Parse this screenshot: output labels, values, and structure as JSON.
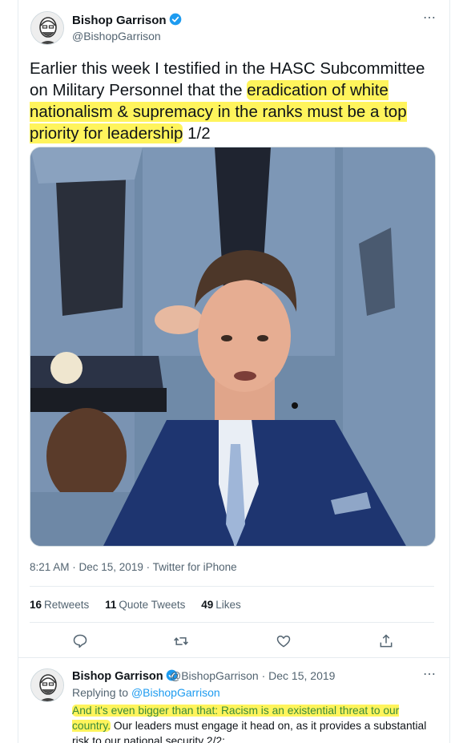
{
  "tweet": {
    "author_name": "Bishop Garrison",
    "author_handle": "@BishopGarrison",
    "text_before": "Earlier this week I testified in the HASC Subcommittee on Military Personnel that the ",
    "text_highlight": "eradication of white nationalism & supremacy in the ranks must be a top priority for leadership",
    "text_after": " 1/2",
    "meta": "8:21 AM · Dec 15, 2019 · Twitter for iPhone",
    "retweets_count": "16",
    "retweets_label": "Retweets",
    "quote_count": "11",
    "quote_label": "Quote Tweets",
    "likes_count": "49",
    "likes_label": "Likes",
    "more_icon": "⋯"
  },
  "reply": {
    "author_name": "Bishop Garrison",
    "handle_date": "@BishopGarrison · Dec 15, 2019",
    "replying_prefix": "Replying to ",
    "replying_handle": "@BishopGarrison",
    "text_highlight": "And it's even bigger than that: Racism is an existential threat to our country.",
    "text_rest": " Our leaders must engage it head on, as it provides a substantial risk to our national security 2/2:",
    "more_icon": "⋯"
  },
  "colors": {
    "highlight": "#fff45c",
    "link": "#1d9bf0",
    "verified": "#1d9bf0",
    "muted": "#536471"
  },
  "icons": [
    "verified-badge-icon",
    "more-icon",
    "reply-icon",
    "retweet-icon",
    "like-icon",
    "share-icon"
  ]
}
